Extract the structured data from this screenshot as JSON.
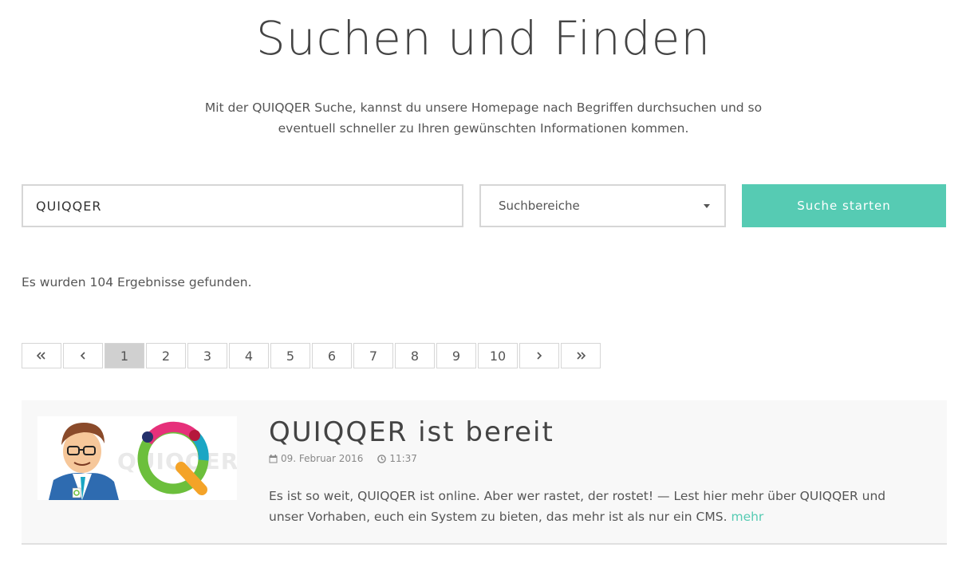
{
  "page": {
    "title": "Suchen und Finden",
    "intro": "Mit der QUIQQER Suche, kannst du unsere Homepage nach Begriffen durchsuchen und so eventuell schneller zu Ihren gewünschten Informationen kommen."
  },
  "search": {
    "value": "QUIQQER",
    "areas_label": "Suchbereiche",
    "button_label": "Suche starten"
  },
  "results": {
    "count_text": "Es wurden 104 Ergebnisse gefunden."
  },
  "pagination": {
    "pages": [
      "1",
      "2",
      "3",
      "4",
      "5",
      "6",
      "7",
      "8",
      "9",
      "10"
    ],
    "current_page": "1",
    "first_icon": "double-chevron-left-icon",
    "prev_icon": "chevron-left-icon",
    "next_icon": "chevron-right-icon",
    "last_icon": "double-chevron-right-icon"
  },
  "entry": {
    "title": "QUIQQER ist bereit",
    "date": "09. Februar 2016",
    "time": "11:37",
    "excerpt": "Es ist so weit, QUIQQER ist online. Aber wer rastet, der rostet! — Lest hier mehr über QUIQQER und unser Vorhaben, euch ein System zu bieten, das mehr ist als nur ein CMS.",
    "more_label": "mehr",
    "image_logo_text": "QUIQQER"
  },
  "colors": {
    "accent": "#56cbb3",
    "logo_pink": "#e6307a",
    "logo_green": "#6cbf3c",
    "logo_teal": "#1aa6c4",
    "logo_orange": "#f4a328",
    "logo_navy": "#24306b",
    "logo_red": "#b5173c"
  }
}
